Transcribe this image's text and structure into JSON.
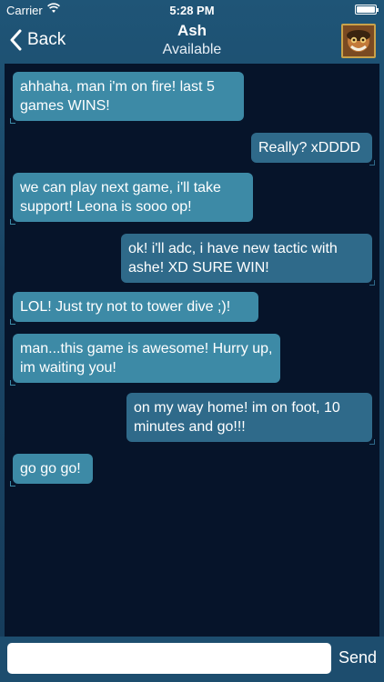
{
  "status_bar": {
    "carrier": "Carrier",
    "time": "5:28 PM"
  },
  "nav": {
    "back_label": "Back",
    "title": "Ash",
    "subtitle": "Available"
  },
  "messages": [
    {
      "direction": "incoming",
      "text": "ahhaha, man i'm on fire! last 5 games WINS!"
    },
    {
      "direction": "outgoing",
      "text": "Really? xDDDD"
    },
    {
      "direction": "incoming",
      "text": "we can play next game, i'll take support! Leona is sooo op!"
    },
    {
      "direction": "outgoing",
      "text": "ok! i'll adc, i have new tactic with ashe! XD SURE WIN!"
    },
    {
      "direction": "incoming",
      "text": "LOL! Just try not to tower dive ;)!"
    },
    {
      "direction": "incoming",
      "text": "man...this game is awesome! Hurry up, im waiting you!"
    },
    {
      "direction": "outgoing",
      "text": "on my way home! im on foot, 10 minutes and go!!!"
    },
    {
      "direction": "incoming",
      "text": "go go go!"
    }
  ],
  "composer": {
    "input_value": "",
    "send_label": "Send"
  },
  "colors": {
    "incoming_bubble": "#3d8aa6",
    "outgoing_bubble": "#2f6a8a",
    "chat_background": "#06142a"
  }
}
